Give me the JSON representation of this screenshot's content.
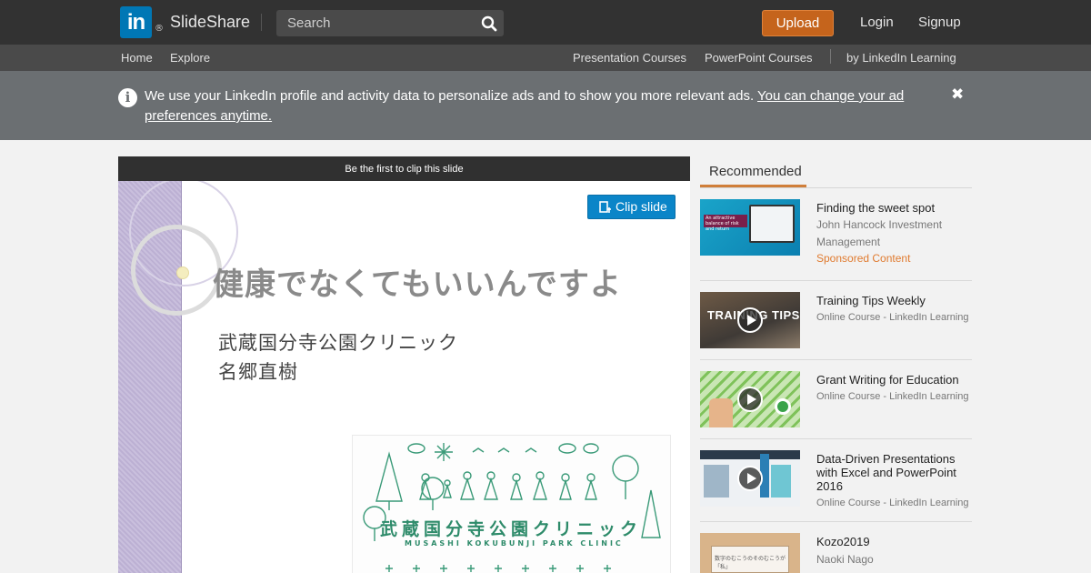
{
  "header": {
    "logo_in": "in",
    "logo_reg": "®",
    "logo_text": "SlideShare",
    "search_placeholder": "Search",
    "upload_label": "Upload",
    "login_label": "Login",
    "signup_label": "Signup"
  },
  "subnav": {
    "home": "Home",
    "explore": "Explore",
    "presentation_courses": "Presentation Courses",
    "powerpoint_courses": "PowerPoint Courses",
    "linkedin_learning": "by LinkedIn Learning"
  },
  "notice": {
    "text": "We use your LinkedIn profile and activity data to personalize ads and to show you more relevant ads. ",
    "link_text": "You can change your ad preferences anytime.",
    "close_glyph": "✖"
  },
  "viewer": {
    "clip_banner": "Be the first to clip this slide",
    "clip_button": "Clip slide",
    "slide_title": "健康でなくてもいいんですよ",
    "slide_line1": "武蔵国分寺公園クリニック",
    "slide_line2": "名郷直樹",
    "clinic_name": "武蔵国分寺公園クリニック",
    "clinic_roman": "MUSASHI KOKUBUNJI PARK CLINIC"
  },
  "sidebar": {
    "tab_label": "Recommended",
    "items": [
      {
        "title": "Finding the sweet spot",
        "meta": "John Hancock Investment Management",
        "sponsored": "Sponsored Content",
        "thumb_text": "An attractive balance of risk and return"
      },
      {
        "title": "Training Tips Weekly",
        "meta": "Online Course - LinkedIn Learning",
        "thumb_text": "TRAINING TIPS"
      },
      {
        "title": "Grant Writing for Education",
        "meta": "Online Course - LinkedIn Learning"
      },
      {
        "title": "Data-Driven Presentations with Excel and PowerPoint 2016",
        "meta": "Online Course - LinkedIn Learning"
      },
      {
        "title": "Kozo2019",
        "meta": "Naoki Nago",
        "thumb_text": "数字のむこうのそのむこうが「私」"
      }
    ]
  },
  "colors": {
    "header_bg": "#323232",
    "subnav_bg": "#4a4a4a",
    "notice_bg": "#6b6f72",
    "upload_orange": "#c5641c",
    "clip_blue": "#0a85c8",
    "tab_accent": "#d07f3a",
    "sponsored_orange": "#e07b30",
    "linkedin_blue": "#0077b5"
  },
  "icons": {
    "search": "magnifier-icon",
    "info": "info-circle-icon",
    "close": "close-x-icon",
    "clip": "clip-add-icon",
    "play": "play-circle-icon"
  }
}
